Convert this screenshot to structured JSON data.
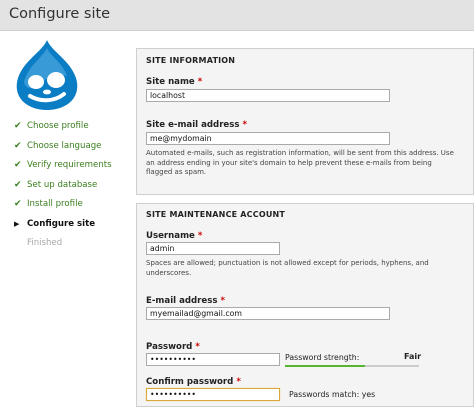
{
  "window": {
    "title": "Configure site"
  },
  "sidebar": {
    "steps": [
      {
        "label": "Choose profile",
        "status": "done"
      },
      {
        "label": "Choose language",
        "status": "done"
      },
      {
        "label": "Verify requirements",
        "status": "done"
      },
      {
        "label": "Set up database",
        "status": "done"
      },
      {
        "label": "Install profile",
        "status": "done"
      },
      {
        "label": "Configure site",
        "status": "current"
      },
      {
        "label": "Finished",
        "status": "pending"
      }
    ]
  },
  "site_information": {
    "legend": "SITE INFORMATION",
    "site_name": {
      "label": "Site name",
      "value": "localhost"
    },
    "site_email": {
      "label": "Site e-mail address",
      "value": "me@mydomain",
      "description": "Automated e-mails, such as registration information, will be sent from this address. Use an address ending in your site's domain to help prevent these e-mails from being flagged as spam."
    }
  },
  "maintenance_account": {
    "legend": "SITE MAINTENANCE ACCOUNT",
    "username": {
      "label": "Username",
      "value": "admin",
      "description": "Spaces are allowed; punctuation is not allowed except for periods, hyphens, and underscores."
    },
    "email": {
      "label": "E-mail address",
      "value": "myemailad@gmail.com"
    },
    "password": {
      "label": "Password",
      "value": "••••••••••"
    },
    "password_strength": {
      "label": "Password strength:",
      "value": "Fair",
      "level": 0.6
    },
    "confirm_password": {
      "label": "Confirm password",
      "value": "••••••••••"
    },
    "passwords_match": {
      "label": "Passwords match:",
      "value": "yes"
    }
  },
  "required_marker": "*",
  "colors": {
    "step_done": "#3a7d1e",
    "step_pending": "#a8a8a8",
    "required": "#cc0000",
    "strength_bar": "#59b432",
    "logo_blue": "#0b7dc4"
  }
}
